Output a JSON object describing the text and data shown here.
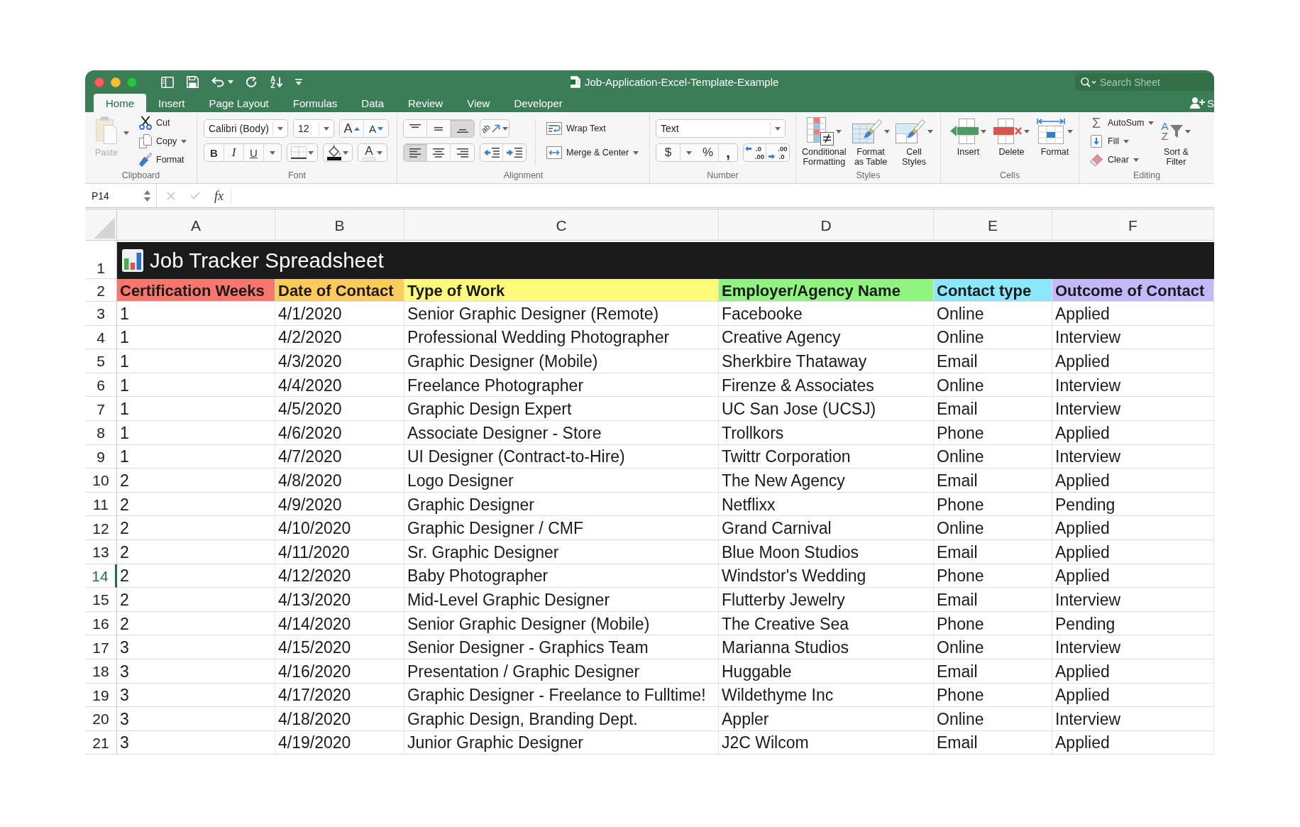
{
  "window": {
    "title": "Job-Application-Excel-Template-Example",
    "search": {
      "placeholder": "Search Sheet"
    },
    "share": {
      "label": "S"
    },
    "quick_access_sort": {
      "top": "A",
      "bottom": "Z"
    }
  },
  "tabs": [
    {
      "label": "Home",
      "selected": true
    },
    {
      "label": "Insert",
      "selected": false
    },
    {
      "label": "Page Layout",
      "selected": false
    },
    {
      "label": "Formulas",
      "selected": false
    },
    {
      "label": "Data",
      "selected": false
    },
    {
      "label": "Review",
      "selected": false
    },
    {
      "label": "View",
      "selected": false
    },
    {
      "label": "Developer",
      "selected": false
    }
  ],
  "ribbon": {
    "clipboard": {
      "label": "Clipboard",
      "paste": {
        "label": "Paste",
        "disabled": true
      },
      "actions": [
        {
          "kind": "cut",
          "label": "Cut"
        },
        {
          "kind": "copy",
          "label": "Copy"
        },
        {
          "kind": "format-painter",
          "label": "Format"
        }
      ]
    },
    "font": {
      "label": "Font",
      "font_name": "Calibri (Body)",
      "font_size": "12",
      "grow_font": "A",
      "shrink_font": "A",
      "bold": "B",
      "italic": "I",
      "underline": "U",
      "font_color": "A"
    },
    "alignment": {
      "label": "Alignment",
      "vertical": [
        {
          "kind": "top",
          "selected": false
        },
        {
          "kind": "middle",
          "selected": false
        },
        {
          "kind": "bottom",
          "selected": true
        }
      ],
      "orientation": "ab",
      "horizontal": [
        {
          "kind": "left",
          "selected": true
        },
        {
          "kind": "center",
          "selected": false
        },
        {
          "kind": "right",
          "selected": false
        }
      ],
      "wrap_text": "Wrap Text",
      "merge_center": "Merge & Center"
    },
    "number": {
      "label": "Number",
      "format": "Text",
      "currency": "$",
      "percent": "%",
      "comma": ",",
      "decimals": [
        {
          "kind": "increase",
          "top": ".0",
          "bottom": ".00"
        },
        {
          "kind": "decrease",
          "top": ".00",
          "bottom": ".0"
        }
      ]
    },
    "styles": {
      "label": "Styles",
      "buttons": [
        {
          "kind": "conditional-formatting",
          "lines": [
            "Conditional",
            "Formatting"
          ]
        },
        {
          "kind": "format-as-table",
          "lines": [
            "Format",
            "as Table"
          ]
        },
        {
          "kind": "cell-styles",
          "lines": [
            "Cell",
            "Styles"
          ]
        }
      ]
    },
    "cells": {
      "label": "Cells",
      "buttons": [
        {
          "kind": "insert",
          "label": "Insert"
        },
        {
          "kind": "delete",
          "label": "Delete"
        },
        {
          "kind": "format",
          "label": "Format"
        }
      ]
    },
    "editing": {
      "label": "Editing",
      "actions": [
        {
          "kind": "autosum",
          "glyph": "Σ",
          "label": "AutoSum"
        },
        {
          "kind": "fill",
          "label": "Fill"
        },
        {
          "kind": "clear",
          "label": "Clear"
        }
      ],
      "sort_filter": {
        "top": "A",
        "bottom": "Z",
        "lines": [
          "Sort &",
          "Filter"
        ]
      }
    }
  },
  "formula_bar": {
    "cell_reference": "P14",
    "function_label": "fx"
  },
  "sheet": {
    "columns": [
      "A",
      "B",
      "C",
      "D",
      "E",
      "F"
    ],
    "title_row": {
      "number": "1",
      "title": "Job Tracker Spreadsheet"
    },
    "header_row": {
      "number": "2",
      "cells": [
        {
          "text": "Certification Weeks",
          "color": "#f8766b"
        },
        {
          "text": "Date of Contact",
          "color": "#fccb5c"
        },
        {
          "text": "Type of Work",
          "color": "#fefb7a"
        },
        {
          "text": "Employer/Agency Name",
          "color": "#8ff480"
        },
        {
          "text": "Contact type",
          "color": "#8be8fb"
        },
        {
          "text": "Outcome of Contact",
          "color": "#c5b7fa"
        }
      ]
    },
    "rows": [
      {
        "number": "3",
        "selected": false,
        "cells": [
          "1",
          "4/1/2020",
          "Senior Graphic Designer (Remote)",
          "Facebooke",
          "Online",
          "Applied"
        ]
      },
      {
        "number": "4",
        "selected": false,
        "cells": [
          "1",
          "4/2/2020",
          "Professional Wedding Photographer",
          "Creative Agency",
          "Online",
          "Interview"
        ]
      },
      {
        "number": "5",
        "selected": false,
        "cells": [
          "1",
          "4/3/2020",
          "Graphic Designer (Mobile)",
          "Sherkbire Thataway",
          "Email",
          "Applied"
        ]
      },
      {
        "number": "6",
        "selected": false,
        "cells": [
          "1",
          "4/4/2020",
          "Freelance Photographer",
          "Firenze & Associates",
          "Online",
          "Interview"
        ]
      },
      {
        "number": "7",
        "selected": false,
        "cells": [
          "1",
          "4/5/2020",
          "Graphic Design Expert",
          "UC San Jose (UCSJ)",
          "Email",
          "Interview"
        ]
      },
      {
        "number": "8",
        "selected": false,
        "cells": [
          "1",
          "4/6/2020",
          "Associate Designer - Store",
          "Trollkors",
          "Phone",
          "Applied"
        ]
      },
      {
        "number": "9",
        "selected": false,
        "cells": [
          "1",
          "4/7/2020",
          "UI Designer (Contract-to-Hire)",
          "Twittr Corporation",
          "Online",
          "Interview"
        ]
      },
      {
        "number": "10",
        "selected": false,
        "cells": [
          "2",
          "4/8/2020",
          "Logo Designer",
          "The New Agency",
          "Email",
          "Applied"
        ]
      },
      {
        "number": "11",
        "selected": false,
        "cells": [
          "2",
          "4/9/2020",
          "Graphic Designer",
          "Netflixx",
          "Phone",
          "Pending"
        ]
      },
      {
        "number": "12",
        "selected": false,
        "cells": [
          "2",
          "4/10/2020",
          "Graphic Designer / CMF",
          "Grand Carnival",
          "Online",
          "Applied"
        ]
      },
      {
        "number": "13",
        "selected": false,
        "cells": [
          "2",
          "4/11/2020",
          "Sr. Graphic Designer",
          "Blue Moon Studios",
          "Email",
          "Applied"
        ]
      },
      {
        "number": "14",
        "selected": true,
        "cells": [
          "2",
          "4/12/2020",
          "Baby Photographer",
          "Windstor's Wedding",
          "Phone",
          "Applied"
        ]
      },
      {
        "number": "15",
        "selected": false,
        "cells": [
          "2",
          "4/13/2020",
          "Mid-Level Graphic Designer",
          "Flutterby Jewelry",
          "Email",
          "Interview"
        ]
      },
      {
        "number": "16",
        "selected": false,
        "cells": [
          "2",
          "4/14/2020",
          "Senior Graphic Designer (Mobile)",
          "The Creative Sea",
          "Phone",
          "Pending"
        ]
      },
      {
        "number": "17",
        "selected": false,
        "cells": [
          "3",
          "4/15/2020",
          "Senior Designer - Graphics Team",
          "Marianna Studios",
          "Online",
          "Interview"
        ]
      },
      {
        "number": "18",
        "selected": false,
        "cells": [
          "3",
          "4/16/2020",
          "Presentation / Graphic Designer",
          "Huggable",
          "Email",
          "Applied"
        ]
      },
      {
        "number": "19",
        "selected": false,
        "cells": [
          "3",
          "4/17/2020",
          "Graphic Designer - Freelance to Fulltime!",
          "Wildethyme Inc",
          "Phone",
          "Applied"
        ]
      },
      {
        "number": "20",
        "selected": false,
        "cells": [
          "3",
          "4/18/2020",
          "Graphic Design, Branding Dept.",
          "Appler",
          "Online",
          "Interview"
        ]
      },
      {
        "number": "21",
        "selected": false,
        "cells": [
          "3",
          "4/19/2020",
          "Junior Graphic Designer",
          "J2C Wilcom",
          "Email",
          "Applied"
        ]
      }
    ]
  }
}
